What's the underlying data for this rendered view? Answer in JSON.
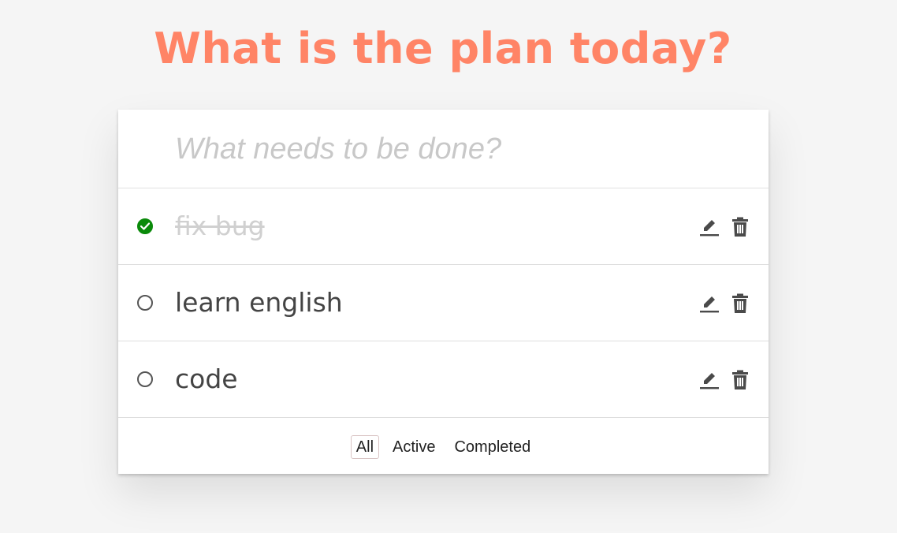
{
  "header": {
    "title": "What is the plan today?"
  },
  "new_todo": {
    "placeholder": "What needs to be done?",
    "value": ""
  },
  "todos": [
    {
      "text": "fix bug",
      "completed": true
    },
    {
      "text": "learn english",
      "completed": false
    },
    {
      "text": "code",
      "completed": false
    }
  ],
  "filters": {
    "all": "All",
    "active": "Active",
    "completed": "Completed",
    "selected": "All"
  },
  "colors": {
    "title": "#ff8466",
    "check": "#0a8a0a"
  },
  "icons": {
    "toggle_done": "check-circle-icon",
    "toggle_open": "circle-icon",
    "edit": "pencil-icon",
    "delete": "trash-icon"
  }
}
